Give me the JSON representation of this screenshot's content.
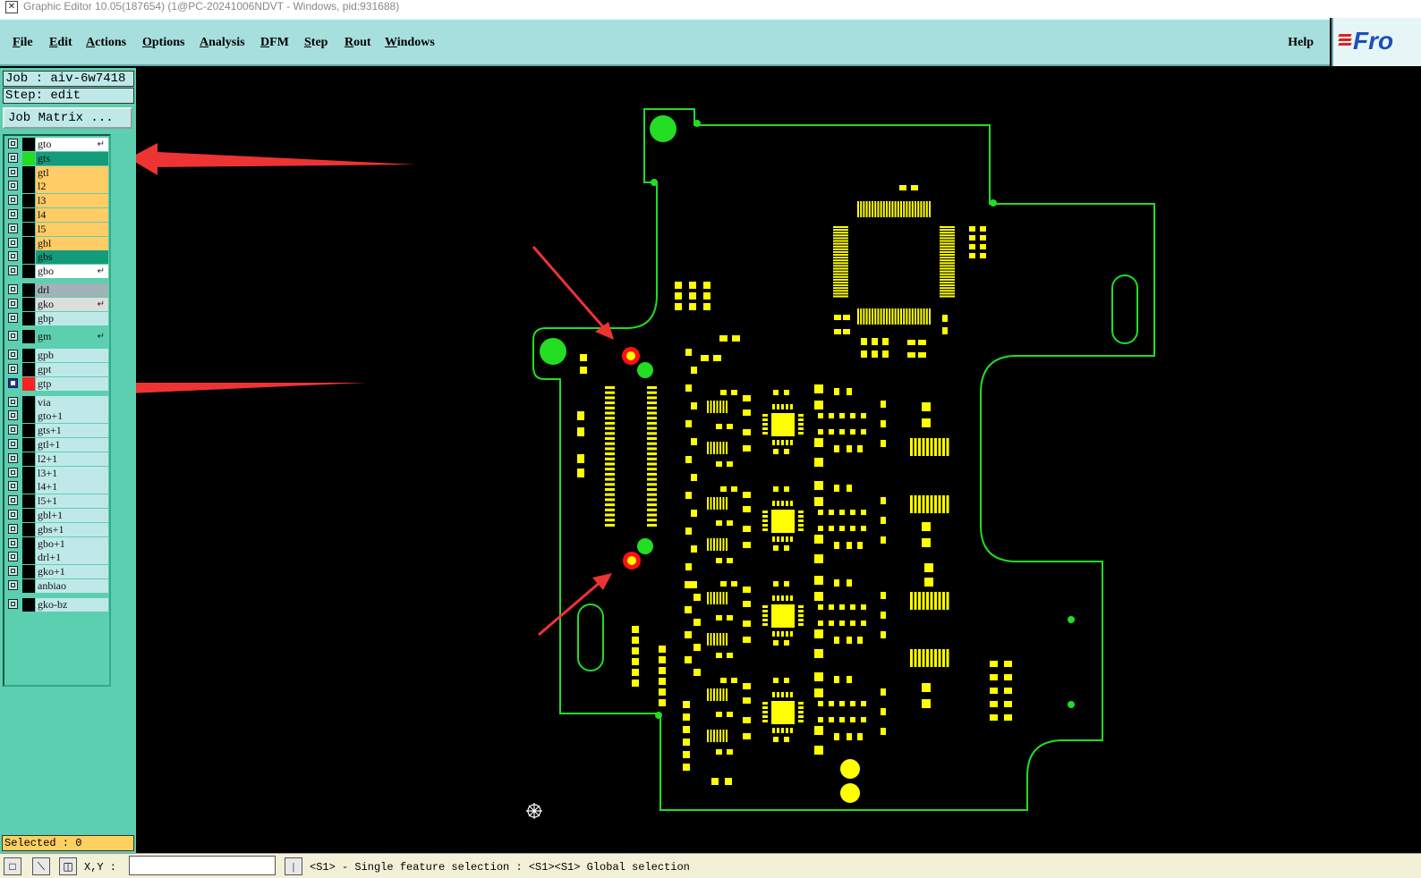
{
  "window": {
    "title": "Graphic Editor 10.05(187654) (1@PC-20241006NDVT - Windows, pid:931688)"
  },
  "menu": {
    "items": [
      "File",
      "Edit",
      "Actions",
      "Options",
      "Analysis",
      "DFM",
      "Step",
      "Rout",
      "Windows"
    ],
    "help": "Help"
  },
  "logo": {
    "text": "Fro"
  },
  "panel": {
    "job": "Job : aiv-6w7418",
    "step": "Step: edit",
    "job_matrix": "Job Matrix ...",
    "selected": "Selected : 0"
  },
  "layers": [
    {
      "name": "gto",
      "color": "#ffffff",
      "swatch": "#000000",
      "mark": "↵"
    },
    {
      "name": "gts",
      "color": "#149b7a",
      "swatch": "#22dd22",
      "mark": ""
    },
    {
      "name": "gtl",
      "color": "#ffcc66",
      "swatch": "#000000",
      "mark": ""
    },
    {
      "name": "l2",
      "color": "#ffcc66",
      "swatch": "#000000",
      "mark": ""
    },
    {
      "name": "l3",
      "color": "#ffcc66",
      "swatch": "#000000",
      "mark": ""
    },
    {
      "name": "l4",
      "color": "#ffcc66",
      "swatch": "#000000",
      "mark": ""
    },
    {
      "name": "l5",
      "color": "#ffcc66",
      "swatch": "#000000",
      "mark": ""
    },
    {
      "name": "gbl",
      "color": "#ffcc66",
      "swatch": "#000000",
      "mark": ""
    },
    {
      "name": "gbs",
      "color": "#149b7a",
      "swatch": "#000000",
      "mark": ""
    },
    {
      "name": "gbo",
      "color": "#ffffff",
      "swatch": "#000000",
      "mark": "↵"
    },
    {
      "name": "drl",
      "color": "#9fb3b8",
      "swatch": "#000000",
      "mark": ""
    },
    {
      "name": "gko",
      "color": "#dddddd",
      "swatch": "#000000",
      "mark": "↵"
    },
    {
      "name": "gbp",
      "color": "#bfe9e9",
      "swatch": "#000000",
      "mark": ""
    },
    {
      "name": "gm",
      "color": "#5ccfb0",
      "swatch": "#000000",
      "mark": "↵"
    },
    {
      "name": "gpb",
      "color": "#bfe9e9",
      "swatch": "#000000",
      "mark": ""
    },
    {
      "name": "gpt",
      "color": "#bfe9e9",
      "swatch": "#000000",
      "mark": ""
    },
    {
      "name": "gtp",
      "color": "#bfe9e9",
      "swatch": "#ff2020",
      "mark": "",
      "active": true
    },
    {
      "name": "via",
      "color": "#bfe9e9",
      "swatch": "#000000",
      "mark": ""
    },
    {
      "name": "gto+1",
      "color": "#bfe9e9",
      "swatch": "#000000",
      "mark": ""
    },
    {
      "name": "gts+1",
      "color": "#bfe9e9",
      "swatch": "#000000",
      "mark": ""
    },
    {
      "name": "gtl+1",
      "color": "#bfe9e9",
      "swatch": "#000000",
      "mark": ""
    },
    {
      "name": "l2+1",
      "color": "#bfe9e9",
      "swatch": "#000000",
      "mark": ""
    },
    {
      "name": "l3+1",
      "color": "#bfe9e9",
      "swatch": "#000000",
      "mark": ""
    },
    {
      "name": "l4+1",
      "color": "#bfe9e9",
      "swatch": "#000000",
      "mark": ""
    },
    {
      "name": "l5+1",
      "color": "#bfe9e9",
      "swatch": "#000000",
      "mark": ""
    },
    {
      "name": "gbl+1",
      "color": "#bfe9e9",
      "swatch": "#000000",
      "mark": ""
    },
    {
      "name": "gbs+1",
      "color": "#bfe9e9",
      "swatch": "#000000",
      "mark": ""
    },
    {
      "name": "gbo+1",
      "color": "#bfe9e9",
      "swatch": "#000000",
      "mark": ""
    },
    {
      "name": "drl+1",
      "color": "#bfe9e9",
      "swatch": "#000000",
      "mark": ""
    },
    {
      "name": "gko+1",
      "color": "#bfe9e9",
      "swatch": "#000000",
      "mark": ""
    },
    {
      "name": "anbiao",
      "color": "#bfe9e9",
      "swatch": "#000000",
      "mark": ""
    },
    {
      "name": "gko-bz",
      "color": "#bfe9e9",
      "swatch": "#000000",
      "mark": ""
    }
  ],
  "status": {
    "xy_label": "X,Y :",
    "message": "<S1> - Single feature selection : <S1><S1> Global selection"
  },
  "colors": {
    "outline": "#22dd22",
    "pad": "#ffff00",
    "hole": "#ff1010",
    "arrow": "#ee3333"
  }
}
